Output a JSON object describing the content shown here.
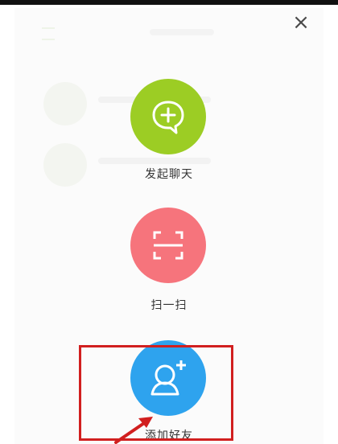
{
  "header": {
    "close_glyph": "×"
  },
  "menu": {
    "items": [
      {
        "label": "发起聊天",
        "icon": "chat-plus-icon",
        "color": "#9ccd24"
      },
      {
        "label": "扫一扫",
        "icon": "scan-icon",
        "color": "#f6747c"
      },
      {
        "label": "添加好友",
        "icon": "add-friend-icon",
        "color": "#2ea3ee"
      }
    ]
  },
  "annotation": {
    "highlight_color": "#d11f1f",
    "highlighted_item": "添加好友"
  }
}
